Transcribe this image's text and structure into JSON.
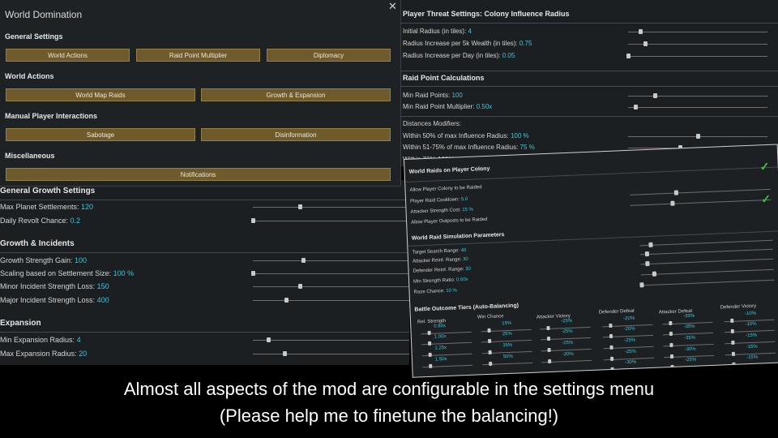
{
  "world_window": {
    "title": "World Domination",
    "close_glyph": "✕",
    "general_settings": {
      "heading": "General Settings",
      "buttons": [
        "World Actions",
        "Raid Point Multiplier",
        "Diplomacy"
      ]
    },
    "world_actions": {
      "heading": "World Actions",
      "buttons": [
        "World Map Raids",
        "Growth & Expansion"
      ]
    },
    "manual_interactions": {
      "heading": "Manual Player Interactions",
      "buttons": [
        "Sabotage",
        "Disinformation"
      ]
    },
    "misc": {
      "heading": "Miscellaneous",
      "buttons": [
        "Notifications"
      ]
    }
  },
  "growth_panel": {
    "general_growth": {
      "heading": "General Growth Settings",
      "rows": [
        {
          "label": "Max Planet Settlements: ",
          "value": "120",
          "level": 0.3
        },
        {
          "label": "Daily Revolt Chance: ",
          "value": "0.2",
          "level": 0.0
        }
      ]
    },
    "growth_incidents": {
      "heading": "Growth & Incidents",
      "rows": [
        {
          "label": "Growth Strength Gain: ",
          "value": "100",
          "level": 0.32
        },
        {
          "label": "Scaling based on Settlement Size: ",
          "value": "100 %",
          "level": 0.0
        },
        {
          "label": "Minor Incident Strength Loss: ",
          "value": "150",
          "level": 0.3
        },
        {
          "label": "Major Incident Strength Loss: ",
          "value": "400",
          "level": 0.21
        }
      ]
    },
    "expansion": {
      "heading": "Expansion",
      "rows": [
        {
          "label": "Min Expansion Radius: ",
          "value": "4",
          "level": 0.1
        },
        {
          "label": "Max Expansion Radius: ",
          "value": "20",
          "level": 0.2
        }
      ]
    }
  },
  "threat_panel": {
    "threat": {
      "heading": "Player Threat Settings: Colony Influence Radius",
      "rows": [
        {
          "label": "Initial Radius (in tiles): ",
          "value": "4",
          "level": 0.09
        },
        {
          "label": "Radius Increase per 5k Wealth (in tiles): ",
          "value": "0.75",
          "level": 0.12
        },
        {
          "label": "Radius Increase per Day (in tiles): ",
          "value": "0.05",
          "level": 0.0
        }
      ]
    },
    "raid_points": {
      "heading": "Raid Point Calculations",
      "rows": [
        {
          "label": "Min Raid Points: ",
          "value": "100",
          "level": 0.19
        },
        {
          "label": "Min Raid Point Multiplier: ",
          "value": "0.50x",
          "level": 0.05
        }
      ]
    },
    "distances": {
      "heading": "Distances Modifiers:",
      "rows": [
        {
          "label": "Within 50% of max Influence Radius: ",
          "value": "100 %",
          "level": 0.5
        },
        {
          "label": "Within 51-75% of max Influence Radius: ",
          "value": "75 %",
          "level": 0.37
        },
        {
          "label": "Within 76%-100% of max Influence Radius: ",
          "value": "50 %",
          "level": 0.25
        }
      ]
    }
  },
  "raids_panel": {
    "colony": {
      "heading": "World Raids on Player Colony",
      "rows": [
        {
          "label": "Allow Player Colony to be Raided",
          "value": "",
          "checked": true
        },
        {
          "label": "Player Raid Cooldown: ",
          "value": "5.0",
          "level": 0.33
        },
        {
          "label": "Attacker Strength Cost: ",
          "value": "15 %",
          "level": 0.3
        },
        {
          "label": "Allow Player Outposts to be Raided",
          "value": "",
          "checked": true
        }
      ]
    },
    "simulation": {
      "heading": "World Raid Simulation Parameters",
      "rows": [
        {
          "label": "Target Search Range: ",
          "value": "40",
          "level": 0.08
        },
        {
          "label": "Attacker Reinf. Range: ",
          "value": "30",
          "level": 0.05
        },
        {
          "label": "Defender Reinf. Range: ",
          "value": "30",
          "level": 0.05
        },
        {
          "label": "Min Strength Ratio: ",
          "value": "0.60x",
          "level": 0.1
        },
        {
          "label": "Raze Chance: ",
          "value": "10 %",
          "level": 0.0
        }
      ]
    },
    "battle": {
      "heading": "Battle Outcome Tiers (Auto-Balancing)",
      "columns": [
        "Rel. Strength",
        "Win Chance",
        "Attacker Victory",
        "Defender Defeat",
        "Attacker Defeat",
        "Defender Victory"
      ],
      "rows": [
        [
          "0.80x",
          "15%",
          "-25%",
          "-20%",
          "-35%",
          "-10%"
        ],
        [
          "1.00x",
          "25%",
          "-25%",
          "-20%",
          "-35%",
          "-10%"
        ],
        [
          "1.25x",
          "35%",
          "-25%",
          "-25%",
          "-35%",
          "-15%"
        ],
        [
          "1.50x",
          "50%",
          "-20%",
          "-25%",
          "-30%",
          "-15%"
        ],
        [
          "",
          "",
          "",
          "-30%",
          "-25%",
          "-15%"
        ]
      ]
    }
  },
  "caption": {
    "line1": "Almost all aspects of the mod are configurable in the settings menu",
    "line2": "(Please help me to finetune the balancing!)"
  }
}
